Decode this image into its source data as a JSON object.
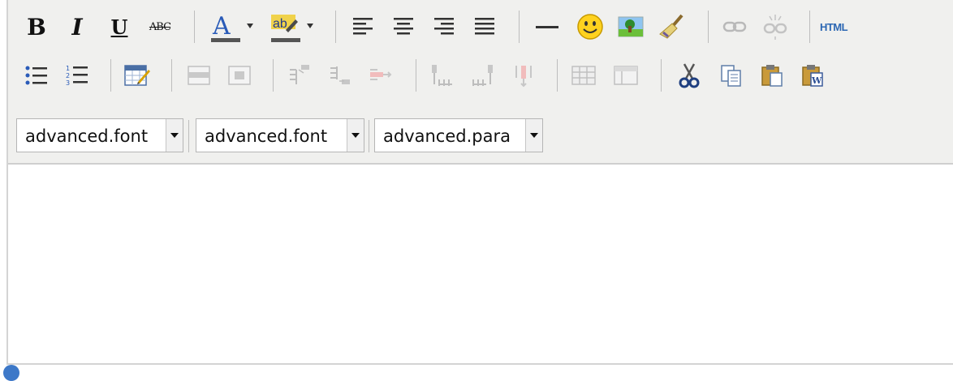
{
  "toolbar": {
    "row1": {
      "buttons": [
        {
          "name": "bold-button",
          "label": "B"
        },
        {
          "name": "italic-button",
          "label": "I"
        },
        {
          "name": "underline-button",
          "label": "U"
        },
        {
          "name": "strikethrough-button",
          "label": "ABC"
        },
        {
          "name": "forecolor-button",
          "label": "A"
        },
        {
          "name": "backcolor-button",
          "label": "ab"
        },
        {
          "name": "html-button",
          "label": "HTML"
        }
      ],
      "colors": {
        "forecolor": "#2a5bb8",
        "backcolor": "#e3b400"
      }
    },
    "selects": [
      {
        "name": "font-family-select",
        "value": "advanced.font"
      },
      {
        "name": "font-size-select",
        "value": "advanced.font"
      },
      {
        "name": "paragraph-format-select",
        "value": "advanced.para"
      }
    ]
  },
  "colors": {
    "toolbar_bg": "#f0f0ee",
    "border": "#d4d4d4",
    "disabled_icon": "#b9b9b9",
    "link_blue": "#2c67b3"
  }
}
